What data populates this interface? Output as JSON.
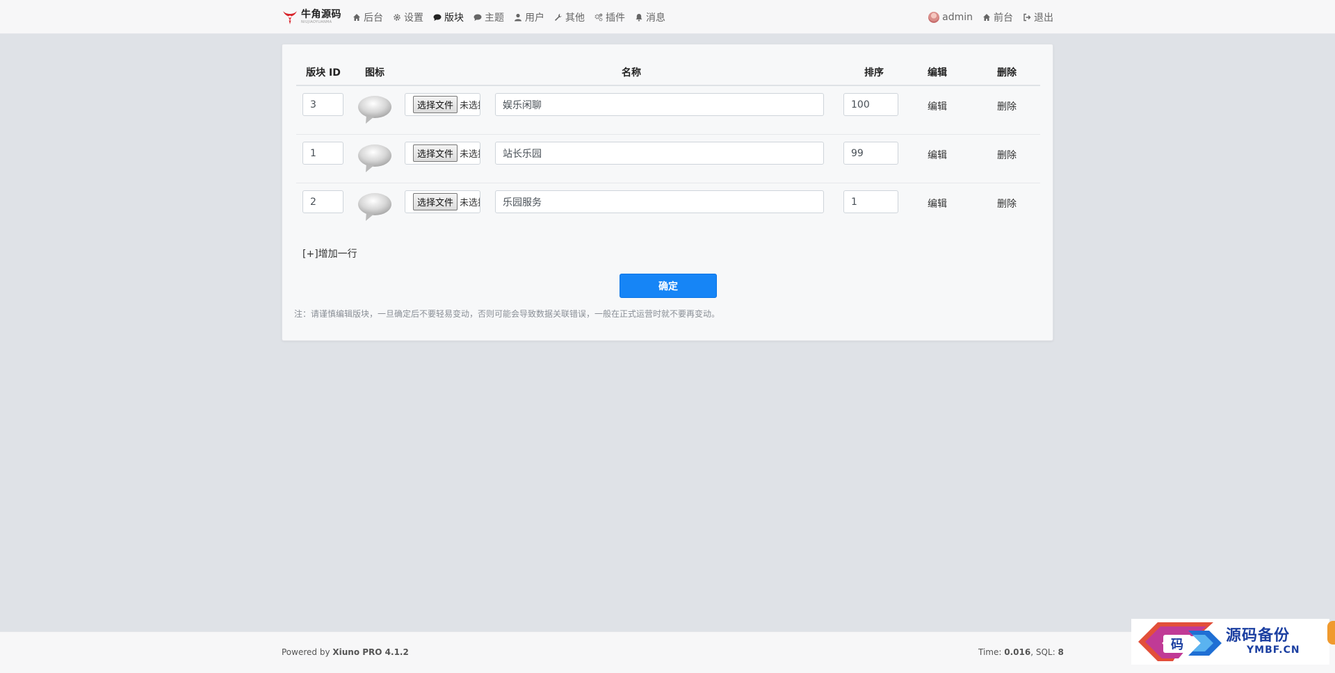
{
  "brand": {
    "name": "牛角源码",
    "sub": "NIUJIAOYUANMA"
  },
  "nav": {
    "items": [
      {
        "label": "后台",
        "icon": "home-icon"
      },
      {
        "label": "设置",
        "icon": "gear-icon"
      },
      {
        "label": "版块",
        "icon": "comment-icon",
        "active": true
      },
      {
        "label": "主题",
        "icon": "comment-icon"
      },
      {
        "label": "用户",
        "icon": "user-icon"
      },
      {
        "label": "其他",
        "icon": "wrench-icon"
      },
      {
        "label": "插件",
        "icon": "gears-icon"
      },
      {
        "label": "消息",
        "icon": "bell-icon"
      }
    ],
    "right": {
      "user": "admin",
      "front": "前台",
      "logout": "退出"
    }
  },
  "table": {
    "headers": {
      "id": "版块 ID",
      "icon": "图标",
      "name": "名称",
      "rank": "排序",
      "edit": "编辑",
      "delete": "删除"
    },
    "rows": [
      {
        "id": "3",
        "name": "娱乐闲聊",
        "rank": "100",
        "file_button": "选择文件",
        "file_status": "未选择任何文件",
        "edit": "编辑",
        "delete": "删除"
      },
      {
        "id": "1",
        "name": "站长乐园",
        "rank": "99",
        "file_button": "选择文件",
        "file_status": "未选择任何文件",
        "edit": "编辑",
        "delete": "删除"
      },
      {
        "id": "2",
        "name": "乐园服务",
        "rank": "1",
        "file_button": "选择文件",
        "file_status": "未选择任何文件",
        "edit": "编辑",
        "delete": "删除"
      }
    ]
  },
  "actions": {
    "add_row": "[+]增加一行",
    "submit": "确定",
    "note": "注：请谨慎编辑版块，一旦确定后不要轻易变动，否则可能会导致数据关联错误，一般在正式运营时就不要再变动。"
  },
  "footer": {
    "powered_prefix": "Powered by ",
    "powered_name": "Xiuno PRO 4.1.2",
    "time_label": "Time: ",
    "time_value": "0.016",
    "sql_label": ", SQL: ",
    "sql_value": "8"
  },
  "watermark": {
    "cn": "源码备份",
    "en": "YMBF.CN",
    "glyph": "码"
  },
  "colors": {
    "primary": "#1685f6",
    "brand_red": "#d8232a",
    "watermark_blue": "#1b3fa1"
  }
}
